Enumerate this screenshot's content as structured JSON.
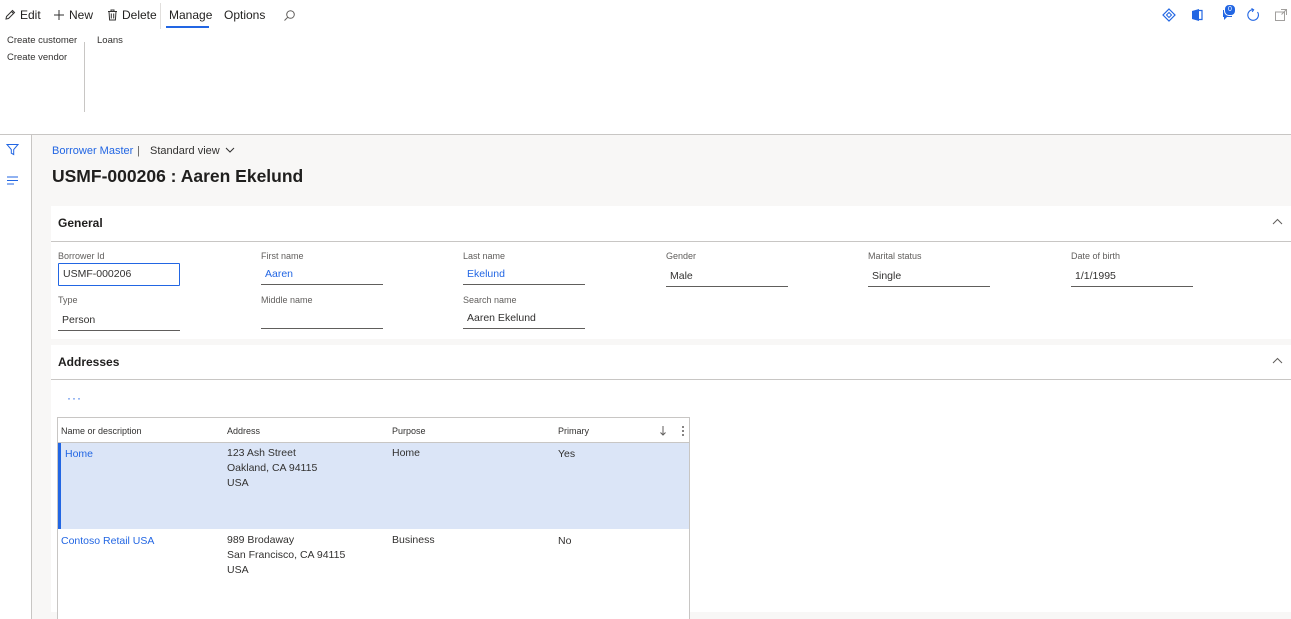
{
  "toolbar": {
    "edit_label": "Edit",
    "new_label": "New",
    "delete_label": "Delete",
    "tabs": [
      {
        "label": "Manage",
        "active": true
      },
      {
        "label": "Options",
        "active": false
      }
    ],
    "notification_count": "0"
  },
  "ribbon": {
    "group1": [
      "Create customer",
      "Create vendor"
    ],
    "group2": [
      "Loans"
    ]
  },
  "breadcrumb": {
    "form_name": "Borrower Master",
    "separator": "|",
    "view": "Standard view"
  },
  "page_title": "USMF-000206 : Aaren Ekelund",
  "general": {
    "title": "General",
    "fields": {
      "borrower_id": {
        "label": "Borrower Id",
        "value": "USMF-000206"
      },
      "first_name": {
        "label": "First name",
        "value": "Aaren"
      },
      "last_name": {
        "label": "Last name",
        "value": "Ekelund"
      },
      "gender": {
        "label": "Gender",
        "value": "Male"
      },
      "marital_status": {
        "label": "Marital status",
        "value": "Single"
      },
      "date_of_birth": {
        "label": "Date of birth",
        "value": "1/1/1995"
      },
      "type": {
        "label": "Type",
        "value": "Person"
      },
      "middle_name": {
        "label": "Middle name",
        "value": ""
      },
      "search_name": {
        "label": "Search name",
        "value": "Aaren Ekelund"
      }
    }
  },
  "addresses": {
    "title": "Addresses",
    "more_label": "···",
    "columns": [
      "Name or description",
      "Address",
      "Purpose",
      "Primary"
    ],
    "rows": [
      {
        "name": "Home",
        "address": [
          "123 Ash Street",
          "Oakland, CA 94115",
          "USA"
        ],
        "purpose": "Home",
        "primary": "Yes",
        "selected": true
      },
      {
        "name": "Contoso Retail USA",
        "address": [
          "989 Brodaway",
          "San Francisco, CA 94115",
          "USA"
        ],
        "purpose": "Business",
        "primary": "No",
        "selected": false
      }
    ]
  },
  "colors": {
    "accent": "#2266e3",
    "selected_row": "#dbe5f7"
  }
}
